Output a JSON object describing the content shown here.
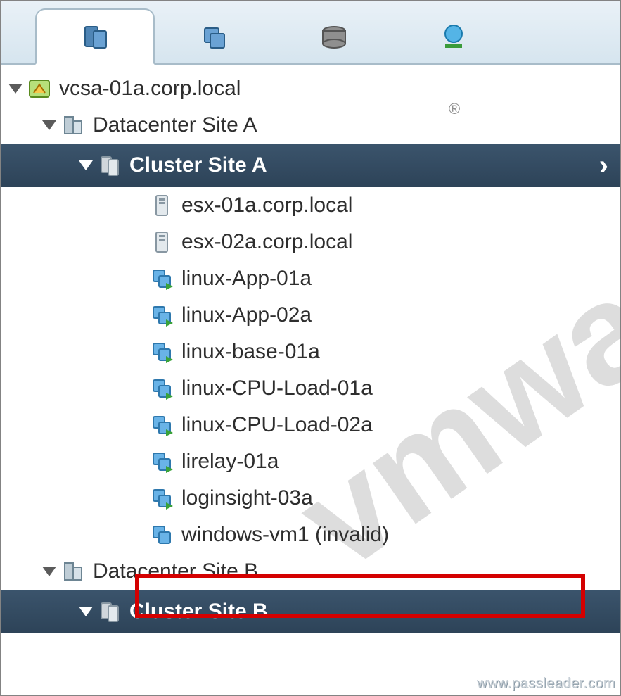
{
  "watermark_text": "vmware",
  "url_watermark": "www.passleader.com",
  "tabs": {
    "hosts_clusters": "hosts-and-clusters",
    "vms_templates": "vms-and-templates",
    "storage": "storage",
    "networking": "networking"
  },
  "tree": {
    "vcenter": "vcsa-01a.corp.local",
    "dc_a": "Datacenter Site A",
    "cluster_a": "Cluster Site A",
    "hosts": {
      "h1": "esx-01a.corp.local",
      "h2": "esx-02a.corp.local"
    },
    "vms": {
      "v1": "linux-App-01a",
      "v2": "linux-App-02a",
      "v3": "linux-base-01a",
      "v4": "linux-CPU-Load-01a",
      "v5": "linux-CPU-Load-02a",
      "v6": "lirelay-01a",
      "v7": "loginsight-03a",
      "v8": "windows-vm1 (invalid)"
    },
    "dc_b": "Datacenter Site B",
    "cluster_b": "Cluster Site B"
  },
  "registered_mark": "®"
}
